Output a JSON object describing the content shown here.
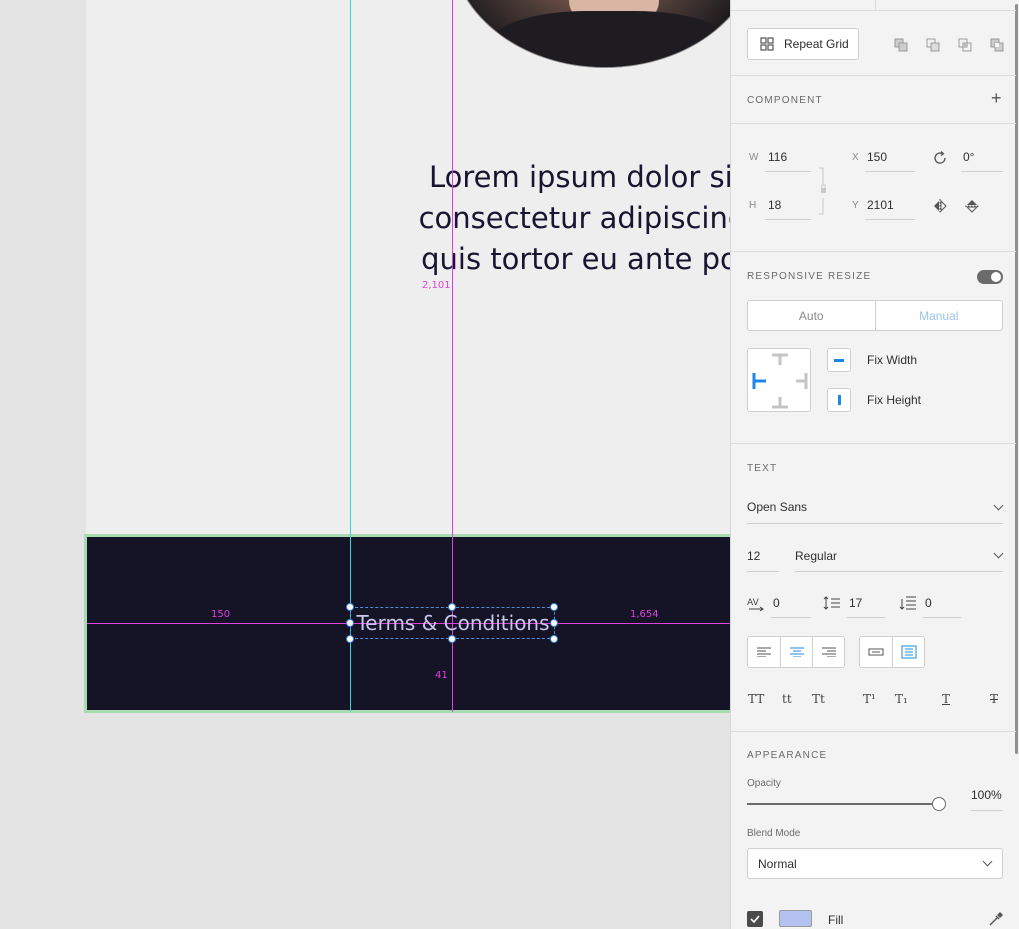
{
  "canvas": {
    "headline_lines": [
      "Lorem ipsum dolor sit a",
      "consectetur adipiscing el",
      "quis tortor eu ante porta"
    ],
    "terms_text": "Terms & Conditions",
    "measure_top": "2,101",
    "measure_left": "150",
    "measure_right": "1,654",
    "measure_bottom": "41"
  },
  "panel": {
    "repeat_grid_label": "Repeat Grid",
    "component_title": "COMPONENT",
    "component_add": "+",
    "transform": {
      "w_label": "W",
      "w_value": "116",
      "h_label": "H",
      "h_value": "18",
      "x_label": "X",
      "x_value": "150",
      "y_label": "Y",
      "y_value": "2101",
      "rotation": "0°"
    },
    "responsive": {
      "title": "RESPONSIVE RESIZE",
      "toggle_on": true,
      "auto_label": "Auto",
      "manual_label": "Manual",
      "fix_width": "Fix Width",
      "fix_height": "Fix Height"
    },
    "text": {
      "title": "TEXT",
      "font_family": "Open Sans",
      "font_size": "12",
      "font_weight": "Regular",
      "char_spacing": "0",
      "line_spacing": "17",
      "para_spacing": "0",
      "case_upper": "TT",
      "case_lower": "tt",
      "case_title": "Tt",
      "superscript": "T¹",
      "subscript": "T₁",
      "underline": "T",
      "strike": "T"
    },
    "appearance": {
      "title": "APPEARANCE",
      "opacity_label": "Opacity",
      "opacity_value": "100%",
      "opacity_fraction": 1.0,
      "blend_label": "Blend Mode",
      "blend_value": "Normal",
      "fill_label": "Fill",
      "fill_color": "#b3c2f0"
    },
    "colors": {
      "accent": "#1e88e5",
      "guide_cyan": "#39d4d4",
      "guide_magenta": "#e040e0",
      "footer_bg": "#151326"
    }
  }
}
